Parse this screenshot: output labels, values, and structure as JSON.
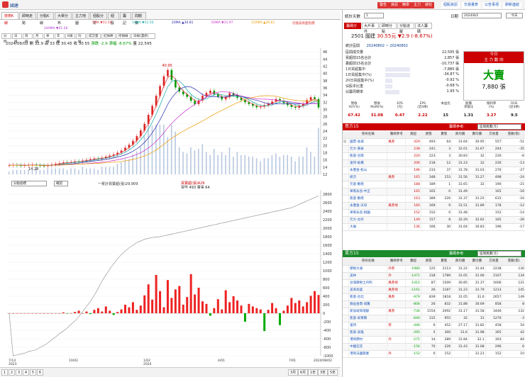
{
  "app": {
    "title": "國建"
  },
  "toolbar_right": [
    "警告",
    "資訊",
    "精準",
    "主力",
    "總柱"
  ],
  "toolbar_links": [
    "個股資訊",
    "交易量表",
    "公告事項",
    "刷新連結"
  ],
  "tabs": [
    "技術K線",
    "即時走勢",
    "分點K線",
    "大單分布",
    "主力地圖",
    "個股分析",
    "個股",
    "籌記",
    "問觀察"
  ],
  "ma_legend": [
    {
      "label": "5MA ▼31.50",
      "color": "#d33"
    },
    {
      "label": "10MA ▼31.50",
      "color": "#1aa"
    },
    {
      "label": "20MA ▲30.81",
      "color": "#22a"
    },
    {
      "label": "60MA ▼31.97",
      "color": "#c3c"
    },
    {
      "label": "120MA ▲29.61",
      "color": "#e90"
    },
    {
      "label": "240MA ▼21.26",
      "color": "#a3c"
    },
    {
      "label": "切換技術面指標",
      "color": "#d33"
    }
  ],
  "chart_toolbar": [
    "分時",
    "日線",
    "周線",
    "月線",
    "季線",
    "年線",
    "K線",
    "均線",
    "成交量",
    "紅綠棒",
    "停損線",
    "日線(還原)"
  ],
  "ohlc": {
    "date": "2024/08/02",
    "open": "開 32.9",
    "high": "高 33",
    "low": "低 30.45",
    "close": "收 30.55",
    "change": "漲跌 -2.9",
    "pct": "漲幅 -8.67%",
    "vol": "量 22,595"
  },
  "price_axis": [
    "46",
    "44",
    "42",
    "40",
    "38",
    "36",
    "34",
    "32",
    "30",
    "28",
    "26",
    "24",
    "22",
    "20",
    "18",
    "16",
    "14",
    "12"
  ],
  "price_annotations": {
    "high": "40.95",
    "low": "14.28"
  },
  "flow_head": {
    "select": "分點指標",
    "btn": "確認",
    "legend1": "一累計買賣超(張)29,909",
    "legend2": "買賣超(張)429",
    "legend3": "買性 493 賣張 64"
  },
  "flow_axis": [
    "2800",
    "2600",
    "2400",
    "2200",
    "2000",
    "1800",
    "1600",
    "1400",
    "1200",
    "1000",
    "800",
    "600",
    "400",
    "200",
    "0",
    "-200",
    "-400",
    "-600",
    "-800",
    "-1000"
  ],
  "x_axis": [
    "7/14\n2023",
    "10/02",
    "1/02\n2024",
    "4/01",
    "7/01",
    "2024/08/02"
  ],
  "pager": [
    "1",
    "2",
    "3",
    "4",
    "5",
    "6"
  ],
  "ranges": [
    "3月",
    "6月",
    "1年",
    "3年",
    "5年"
  ],
  "rp": {
    "stat_days_label": "統計天數",
    "stat_days_value": "1",
    "date_label": "日期",
    "date_value": "2024/8/2",
    "today_btn": "今天",
    "rtabs": [
      "籌碼分析",
      "大戶事件",
      "即時分點",
      "分點追蹤",
      "法人籌碼"
    ],
    "stock_code": "2501 國建",
    "price": "30.55元",
    "change": "▼2.9 (-8.67%)",
    "range_label": "統計區間",
    "range_value": "20240802 ~ 20240802",
    "stats": [
      {
        "k": "區間成交量",
        "v": "22,595 張",
        "bar": 0
      },
      {
        "k": "買超前15名合計",
        "v": "2,857 張",
        "bar": 0
      },
      {
        "k": "賣超前15名合計",
        "v": "-10,737 張",
        "bar": 0
      },
      {
        "k": "1日買超集中",
        "v": "-7,880 張",
        "bar": 0.35
      },
      {
        "k": "1日買超集中(%)",
        "v": "-34.87 %",
        "bar": 0.35
      },
      {
        "k": "20日買超集中(%)",
        "v": "-0.92 %",
        "bar": 0.1
      },
      {
        "k": "佔股本比重",
        "v": "-0.68 %",
        "bar": 0.1
      },
      {
        "k": "佔籌周轉率",
        "v": "1.95 %",
        "bar": 0.2
      }
    ],
    "big": {
      "head1": "今日",
      "head2": "主 力 動 向",
      "main": "大賣",
      "sub": "7,880 張"
    },
    "metrics_hdr": [
      "營收\nYoY(%)",
      "營收\nMoM(%)",
      "EPS\n(元)",
      "EPS\n(近4季)",
      "本益比",
      "股價\n淨值比",
      "殖利率\n(%)",
      "ROE\n(近4季)"
    ],
    "metrics_val": [
      "67.42",
      "31.08",
      "0.47",
      "2.22",
      "15",
      "1.31",
      "3.27",
      "9.5"
    ],
    "metrics_colors": [
      "#c00",
      "#c00",
      "#c00",
      "#c00",
      "#222",
      "#222",
      "#c00",
      "#222"
    ],
    "buy_head": "買方15",
    "sell_head": "賣方15",
    "filter_label": "籌碼參考:",
    "filter_value": "區間買賣(元)",
    "cols_buy": [
      "",
      "券商名稱",
      "籌碼參考",
      "買超",
      "買張",
      "賣張",
      "買均價",
      "賣均價",
      "交易量",
      "張數(張)"
    ],
    "cols_sell": [
      "",
      "券商名稱",
      "籌碼參考",
      "賣超",
      "買張",
      "賣張",
      "買均價",
      "賣均價",
      "交易量",
      "張數(張)"
    ],
    "buy_rows": [
      [
        "☑",
        "國票-長城",
        "風券",
        "429",
        "493",
        "64",
        "31.64",
        "30.95",
        "557",
        "-51"
      ],
      [
        "",
        "元大-東泰",
        "",
        "238",
        "241",
        "3",
        "32.01",
        "31.67",
        "244",
        "-35"
      ],
      [
        "",
        "凱基-台南",
        "",
        "220",
        "223",
        "3",
        "30.83",
        "32",
        "226",
        "-6"
      ],
      [
        "",
        "富邦-板橋",
        "",
        "206",
        "218",
        "12",
        "31.23",
        "32",
        "230",
        "-13"
      ],
      [
        "",
        "永豐金-松山",
        "",
        "196",
        "233",
        "37",
        "31.78",
        "31.03",
        "270",
        "-27"
      ],
      [
        "",
        "統元",
        "風券",
        "165",
        "348",
        "153",
        "31.56",
        "31.27",
        "498",
        "-24"
      ],
      [
        "",
        "元富-歡南",
        "",
        "188",
        "189",
        "1",
        "31.65",
        "32",
        "190",
        "-21"
      ],
      [
        "",
        "華南永昌-中正",
        "",
        "165",
        "165",
        "0",
        "31.49",
        "",
        "165",
        "-16"
      ],
      [
        "",
        "凱基-歡南",
        "",
        "163",
        "389",
        "226",
        "31.37",
        "31.25",
        "615",
        "-16"
      ],
      [
        "",
        "永豐金-天母",
        "風券地",
        "160",
        "169",
        "9",
        "31.51",
        "31.89",
        "178",
        "-12"
      ],
      [
        "",
        "華南永昌-桃園",
        "",
        "152",
        "152",
        "0",
        "31.48",
        "",
        "152",
        "-14"
      ],
      [
        "",
        "元大-古亭",
        "",
        "149",
        "157",
        "8",
        "32.29",
        "32.62",
        "165",
        "-26"
      ],
      [
        "",
        "大展",
        "",
        "136",
        "166",
        "30",
        "31.64",
        "30.83",
        "196",
        "-17"
      ]
    ],
    "sell_rows": [
      [
        "",
        "摩根大通",
        "外券",
        "-1980",
        "125",
        "2113",
        "31.22",
        "31.44",
        "2238",
        "130"
      ],
      [
        "",
        "美林",
        "外",
        "-1471",
        "318",
        "1789",
        "31.05",
        "31.06",
        "2107",
        "134"
      ],
      [
        "",
        "台灣摩根士丹利",
        "風券地",
        "-1412",
        "87",
        "1509",
        "30.85",
        "31.37",
        "1606",
        "121"
      ],
      [
        "",
        "美商高盛",
        "風券地",
        "-1161",
        "26",
        "1187",
        "31.23",
        "31.79",
        "1213",
        "145"
      ],
      [
        "",
        "凱基-台北",
        "風券",
        "-979",
        "839",
        "1818",
        "31.05",
        "31.6",
        "2657",
        "149"
      ],
      [
        "",
        "群益金鼎-城舊",
        "",
        "-806",
        "26",
        "832",
        "31.88",
        "30.69",
        "858",
        "8"
      ],
      [
        "",
        "新加坡商瑞銀",
        "風券",
        "-736",
        "1554",
        "2092",
        "31.17",
        "31.58",
        "3446",
        "132"
      ],
      [
        "",
        "凱基-屏東縣",
        "",
        "-640",
        "315",
        "955",
        "32",
        "31",
        "1270",
        "-3"
      ],
      [
        "",
        "富邦",
        "券",
        "-446",
        "6",
        "452",
        "27.17",
        "31.82",
        "458",
        "54"
      ],
      [
        "",
        "凱基-高雄",
        "",
        "-295",
        "5",
        "300",
        "31.6",
        "31.98",
        "305",
        "42"
      ],
      [
        "",
        "港商野村",
        "外",
        "-275",
        "14",
        "289",
        "31.84",
        "32.1",
        "303",
        "84"
      ],
      [
        "",
        "中國信託",
        "",
        "-156",
        "70",
        "226",
        "31.43",
        "31.08",
        "296",
        "6"
      ],
      [
        "",
        "港商法國興業",
        "外",
        "-152",
        "0",
        "152",
        "",
        "31.21",
        "152",
        "10"
      ]
    ]
  },
  "chart_data": [
    {
      "type": "candlestick",
      "title": "",
      "x_start": "2023/07/14",
      "x_end": "2024/08/02",
      "ylim": [
        12,
        47
      ],
      "close_path": [
        14.5,
        14.6,
        14.5,
        14.4,
        14.5,
        14.6,
        14.7,
        14.5,
        14.4,
        14.3,
        14.5,
        14.7,
        14.9,
        15.1,
        15.3,
        15.2,
        15.4,
        15.6,
        15.5,
        15.8,
        16.0,
        16.2,
        16.4,
        16.3,
        16.6,
        16.9,
        17.2,
        17.5,
        18.0,
        18.6,
        19.4,
        20.2,
        21.3,
        22.6,
        24.2,
        26.0,
        28.5,
        31.0,
        33.8,
        36.5,
        39.2,
        40.95,
        38.2,
        36.1,
        35.0,
        34.2,
        33.5,
        32.4,
        31.5,
        32.5,
        33.8,
        34.6,
        35.2,
        34.2,
        33.6,
        32.8,
        33.4,
        34.5,
        34.0,
        33.2,
        32.6,
        32.0,
        31.5,
        31.0,
        30.6,
        30.8,
        31.2,
        31.6,
        32.2,
        32.9,
        32.4,
        31.8,
        31.2,
        30.7,
        30.5,
        31.0,
        31.5,
        32.6,
        33.4,
        32.9,
        30.55
      ],
      "annotations": [
        {
          "label": "40.95",
          "type": "high"
        },
        {
          "label": "14.28",
          "type": "low"
        }
      ]
    },
    {
      "type": "bar",
      "title": "",
      "series": [
        {
          "name": "買賣超(張)",
          "values": [
            0,
            0,
            0,
            0,
            0,
            0,
            0,
            0,
            0,
            0,
            0,
            0,
            0,
            0,
            20,
            -10,
            0,
            30,
            60,
            0,
            40,
            -20,
            80,
            120,
            40,
            160,
            60,
            -40,
            30,
            90,
            200,
            140,
            260,
            80,
            180,
            420,
            680,
            320,
            900,
            520,
            140,
            780,
            360,
            560,
            640,
            200,
            380,
            920,
            440,
            600,
            280,
            220,
            -60,
            120,
            330,
            90,
            540,
            260,
            400,
            300,
            180,
            -200,
            220,
            160,
            120,
            90,
            -420,
            80,
            240,
            120,
            -280,
            60,
            180,
            360,
            240,
            300,
            160,
            260,
            410,
            520,
            429
          ]
        },
        {
          "name": "累計買賣超(張)",
          "values": [
            0,
            -1000,
            -980,
            -960,
            -940,
            -900,
            -880,
            -860,
            -800,
            -760,
            -700,
            -620,
            -560,
            -480,
            -420,
            -350,
            -260,
            -180,
            -80,
            40,
            160,
            280,
            420,
            580,
            760,
            900,
            1040,
            1160,
            1280,
            1380,
            1460,
            1540,
            1600,
            1660,
            1700,
            1740,
            1760,
            1780,
            1790,
            1800,
            1820,
            1840,
            1860,
            1880,
            1900,
            1920,
            1940,
            1960,
            1980,
            2000,
            2020,
            2040,
            2060,
            2080,
            2100,
            2120,
            2140,
            2160,
            2180,
            2200,
            2220,
            2240,
            2260,
            2280,
            2300,
            2320,
            2340,
            2360,
            2380,
            2400,
            2420,
            2440,
            2460,
            2480,
            2520,
            2560,
            2600,
            2640,
            2680,
            2720,
            2760
          ]
        }
      ],
      "ylim": [
        -1000,
        2900
      ],
      "totals": {
        "cumulative": 29909,
        "today": 429
      }
    }
  ]
}
